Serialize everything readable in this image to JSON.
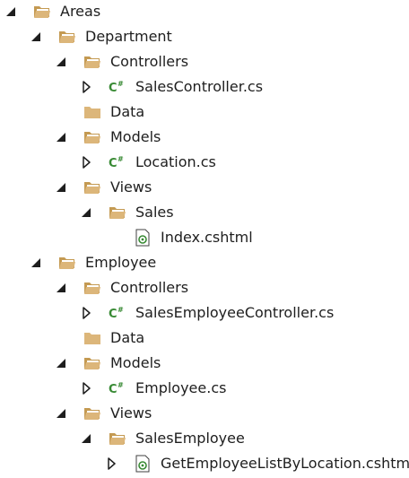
{
  "tree": [
    {
      "label": "Areas",
      "icon": "folder-open-icon",
      "expander": "expanded",
      "depth": 0
    },
    {
      "label": "Department",
      "icon": "folder-open-icon",
      "expander": "expanded",
      "depth": 1
    },
    {
      "label": "Controllers",
      "icon": "folder-open-icon",
      "expander": "expanded",
      "depth": 2
    },
    {
      "label": "SalesController.cs",
      "icon": "csharp-file-icon",
      "expander": "collapsed",
      "depth": 3
    },
    {
      "label": "Data",
      "icon": "folder-closed-icon",
      "expander": "none",
      "depth": 2
    },
    {
      "label": "Models",
      "icon": "folder-open-icon",
      "expander": "expanded",
      "depth": 2
    },
    {
      "label": "Location.cs",
      "icon": "csharp-file-icon",
      "expander": "collapsed",
      "depth": 3
    },
    {
      "label": "Views",
      "icon": "folder-open-icon",
      "expander": "expanded",
      "depth": 2
    },
    {
      "label": "Sales",
      "icon": "folder-open-icon",
      "expander": "expanded",
      "depth": 3
    },
    {
      "label": "Index.cshtml",
      "icon": "razor-file-icon",
      "expander": "none",
      "depth": 4
    },
    {
      "label": "Employee",
      "icon": "folder-open-icon",
      "expander": "expanded",
      "depth": 1
    },
    {
      "label": "Controllers",
      "icon": "folder-open-icon",
      "expander": "expanded",
      "depth": 2
    },
    {
      "label": "SalesEmployeeController.cs",
      "icon": "csharp-file-icon",
      "expander": "collapsed",
      "depth": 3
    },
    {
      "label": "Data",
      "icon": "folder-closed-icon",
      "expander": "none",
      "depth": 2
    },
    {
      "label": "Models",
      "icon": "folder-open-icon",
      "expander": "expanded",
      "depth": 2
    },
    {
      "label": "Employee.cs",
      "icon": "csharp-file-icon",
      "expander": "collapsed",
      "depth": 3
    },
    {
      "label": "Views",
      "icon": "folder-open-icon",
      "expander": "expanded",
      "depth": 2
    },
    {
      "label": "SalesEmployee",
      "icon": "folder-open-icon",
      "expander": "expanded",
      "depth": 3
    },
    {
      "label": "GetEmployeeListByLocation.cshtml",
      "icon": "razor-file-icon",
      "expander": "collapsed",
      "depth": 4
    }
  ],
  "colors": {
    "folder": "#dcb67a",
    "folder_dark": "#c49a52",
    "csharp": "#388a34",
    "razor": "#388a34",
    "expander": "#1e1e1e",
    "text": "#1e1e1e"
  }
}
